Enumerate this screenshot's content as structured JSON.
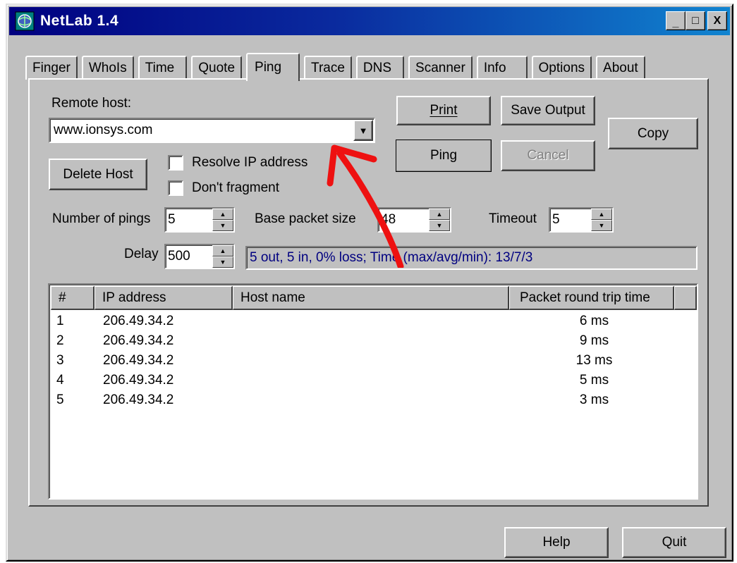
{
  "window": {
    "title": "NetLab 1.4"
  },
  "titlebar": {
    "minimize": "_",
    "maximize": "□",
    "close": "X"
  },
  "tabs": [
    {
      "label": "Finger"
    },
    {
      "label": "WhoIs"
    },
    {
      "label": "Time"
    },
    {
      "label": "Quote"
    },
    {
      "label": "Ping",
      "active": true
    },
    {
      "label": "Trace"
    },
    {
      "label": "DNS"
    },
    {
      "label": "Scanner"
    },
    {
      "label": "Info"
    },
    {
      "label": "Options"
    },
    {
      "label": "About"
    }
  ],
  "ping": {
    "remote_host_label": "Remote host:",
    "remote_host_value": "www.ionsys.com",
    "delete_host_label": "Delete Host",
    "resolve_ip_label": "Resolve IP address",
    "dont_fragment_label": "Don't fragment",
    "print_label": "Print",
    "save_output_label": "Save Output",
    "copy_label": "Copy",
    "ping_label": "Ping",
    "cancel_label": "Cancel",
    "num_pings_label": "Number of pings",
    "num_pings_value": "5",
    "base_packet_label": "Base packet size",
    "base_packet_value": "48",
    "timeout_label": "Timeout",
    "timeout_value": "5",
    "delay_label": "Delay",
    "delay_value": "500",
    "status_text": "5 out, 5 in, 0% loss; Time (max/avg/min): 13/7/3"
  },
  "results": {
    "columns": [
      "#",
      "IP address",
      "Host name",
      "Packet round trip time"
    ],
    "rows": [
      {
        "n": "1",
        "ip": "206.49.34.2",
        "host": "",
        "rtt": "6 ms"
      },
      {
        "n": "2",
        "ip": "206.49.34.2",
        "host": "",
        "rtt": "9 ms"
      },
      {
        "n": "3",
        "ip": "206.49.34.2",
        "host": "",
        "rtt": "13 ms"
      },
      {
        "n": "4",
        "ip": "206.49.34.2",
        "host": "",
        "rtt": "5 ms"
      },
      {
        "n": "5",
        "ip": "206.49.34.2",
        "host": "",
        "rtt": "3 ms"
      }
    ]
  },
  "footer": {
    "help_label": "Help",
    "quit_label": "Quit"
  },
  "colors": {
    "title_start": "#000080",
    "title_end": "#1084d0",
    "status_text": "#000080",
    "annotation": "#ee1111",
    "face": "#c0c0c0"
  }
}
